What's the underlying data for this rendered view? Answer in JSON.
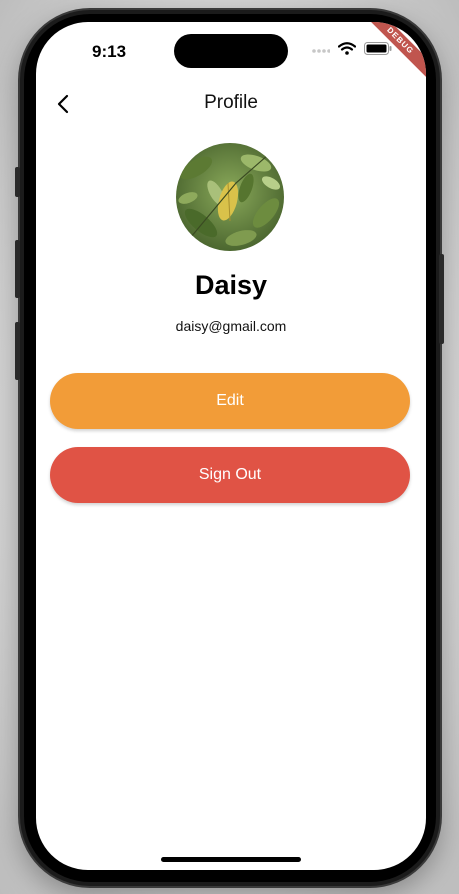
{
  "status_bar": {
    "time": "9:13",
    "icons": [
      "signal-icon",
      "wifi-icon",
      "battery-icon"
    ],
    "debug_banner": "DEBUG"
  },
  "nav": {
    "title": "Profile",
    "back_icon": "chevron-left-icon"
  },
  "profile": {
    "name": "Daisy",
    "email": "daisy@gmail.com"
  },
  "actions": {
    "edit_label": "Edit",
    "signout_label": "Sign Out"
  },
  "colors": {
    "edit_button": "#f29c38",
    "signout_button": "#e05345",
    "background": "#ffffff"
  }
}
